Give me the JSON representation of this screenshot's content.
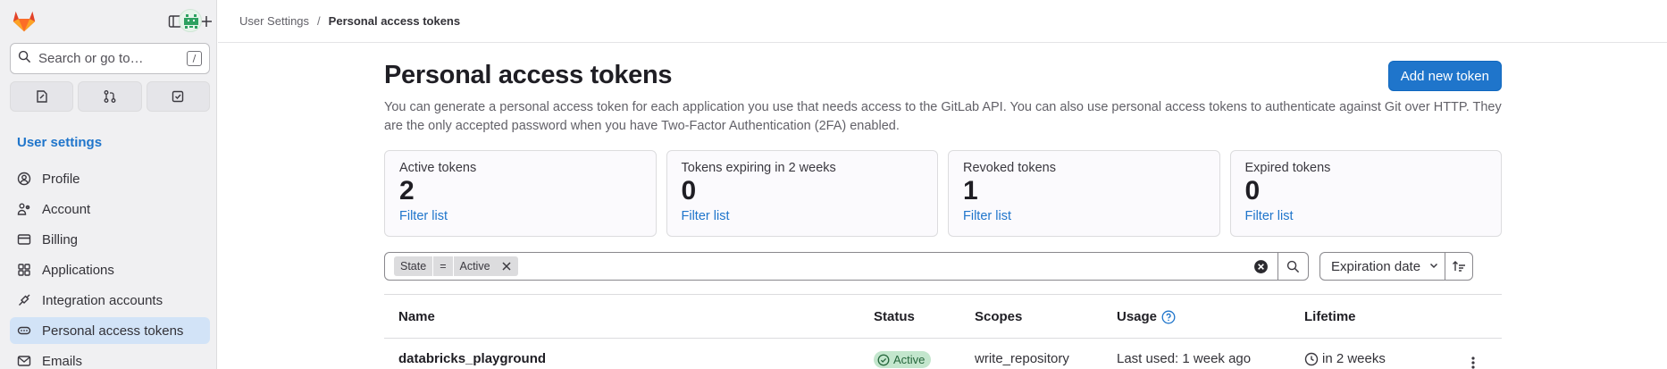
{
  "sidebar": {
    "search_placeholder": "Search or go to…",
    "search_shortcut": "/",
    "section_title": "User settings",
    "items": [
      {
        "label": "Profile",
        "icon": "profile-icon"
      },
      {
        "label": "Account",
        "icon": "account-icon"
      },
      {
        "label": "Billing",
        "icon": "billing-icon"
      },
      {
        "label": "Applications",
        "icon": "applications-icon"
      },
      {
        "label": "Integration accounts",
        "icon": "integration-icon"
      },
      {
        "label": "Personal access tokens",
        "icon": "token-icon",
        "active": true
      },
      {
        "label": "Emails",
        "icon": "email-icon"
      }
    ]
  },
  "breadcrumb": {
    "parent": "User Settings",
    "current": "Personal access tokens"
  },
  "page": {
    "title": "Personal access tokens",
    "add_button": "Add new token",
    "description": "You can generate a personal access token for each application you use that needs access to the GitLab API. You can also use personal access tokens to authenticate against Git over HTTP. They are the only accepted password when you have Two-Factor Authentication (2FA) enabled."
  },
  "stats": [
    {
      "label": "Active tokens",
      "value": "2",
      "link": "Filter list"
    },
    {
      "label": "Tokens expiring in 2 weeks",
      "value": "0",
      "link": "Filter list"
    },
    {
      "label": "Revoked tokens",
      "value": "1",
      "link": "Filter list"
    },
    {
      "label": "Expired tokens",
      "value": "0",
      "link": "Filter list"
    }
  ],
  "filter": {
    "token_field": "State",
    "token_operator": "=",
    "token_value": "Active",
    "sort_label": "Expiration date"
  },
  "table": {
    "headers": {
      "name": "Name",
      "status": "Status",
      "scopes": "Scopes",
      "usage": "Usage",
      "lifetime": "Lifetime"
    },
    "rows": [
      {
        "name": "databricks_playground",
        "status": "Active",
        "scopes": "write_repository",
        "usage": "Last used: 1 week ago",
        "lifetime": "in 2 weeks"
      }
    ]
  },
  "colors": {
    "accent": "#1f75cb",
    "active_nav": "#d2e3f7",
    "badge_bg": "#c3e6cd"
  }
}
